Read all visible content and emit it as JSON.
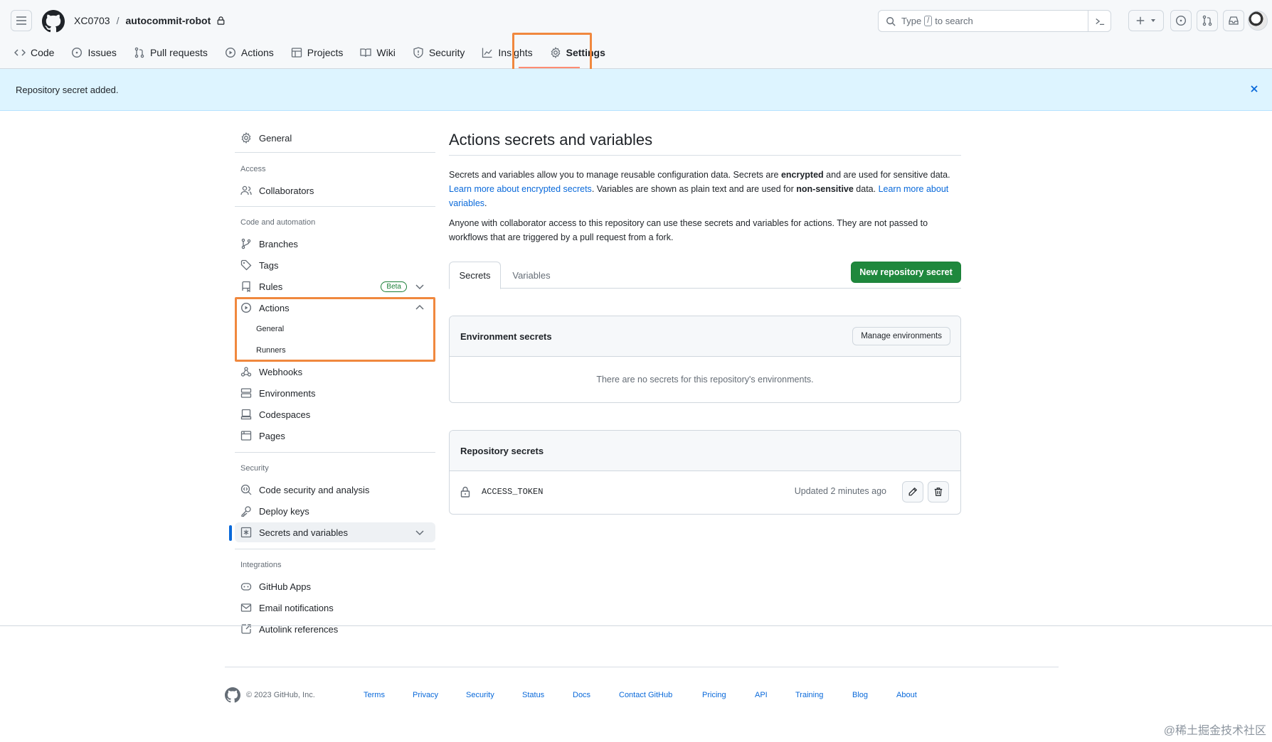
{
  "header": {
    "owner": "XC0703",
    "separator": "/",
    "repo": "autocommit-robot",
    "search": {
      "prefix": "Type",
      "key": "/",
      "suffix": "to search"
    }
  },
  "tabs": [
    {
      "label": "Code",
      "icon": "code-icon"
    },
    {
      "label": "Issues",
      "icon": "issue-opened-icon"
    },
    {
      "label": "Pull requests",
      "icon": "git-pull-request-icon"
    },
    {
      "label": "Actions",
      "icon": "play-icon"
    },
    {
      "label": "Projects",
      "icon": "table-icon"
    },
    {
      "label": "Wiki",
      "icon": "book-icon"
    },
    {
      "label": "Security",
      "icon": "shield-icon"
    },
    {
      "label": "Insights",
      "icon": "graph-icon"
    },
    {
      "label": "Settings",
      "icon": "gear-icon",
      "selected": true
    }
  ],
  "flash": {
    "message": "Repository secret added."
  },
  "sidebar": {
    "general": "General",
    "access_heading": "Access",
    "collaborators": "Collaborators",
    "code_heading": "Code and automation",
    "branches": "Branches",
    "tags": "Tags",
    "rules": "Rules",
    "rules_badge": "Beta",
    "actions": "Actions",
    "actions_general": "General",
    "actions_runners": "Runners",
    "webhooks": "Webhooks",
    "environments": "Environments",
    "codespaces": "Codespaces",
    "pages": "Pages",
    "security_heading": "Security",
    "code_security": "Code security and analysis",
    "deploy_keys": "Deploy keys",
    "secrets": "Secrets and variables",
    "integrations_heading": "Integrations",
    "github_apps": "GitHub Apps",
    "email": "Email notifications",
    "autolink": "Autolink references"
  },
  "main": {
    "title": "Actions secrets and variables",
    "p1_a": "Secrets and variables allow you to manage reusable configuration data. Secrets are ",
    "p1_b": "encrypted",
    "p1_c": " and are used for sensitive data. ",
    "p1_link1": "Learn more about encrypted secrets",
    "p1_d": ". Variables are shown as plain text and are used for ",
    "p1_e": "non-sensitive",
    "p1_f": " data. ",
    "p1_link2": "Learn more about variables",
    "p1_g": ".",
    "p2": "Anyone with collaborator access to this repository can use these secrets and variables for actions. They are not passed to workflows that are triggered by a pull request from a fork.",
    "tab_secrets": "Secrets",
    "tab_variables": "Variables",
    "new_secret_button": "New repository secret",
    "env_heading": "Environment secrets",
    "manage_env_button": "Manage environments",
    "env_empty": "There are no secrets for this repository's environments.",
    "repo_heading": "Repository secrets",
    "secrets": [
      {
        "name": "ACCESS_TOKEN",
        "updated": "Updated 2 minutes ago"
      }
    ]
  },
  "footer": {
    "copyright": "© 2023 GitHub, Inc.",
    "links": [
      "Terms",
      "Privacy",
      "Security",
      "Status",
      "Docs",
      "Contact GitHub",
      "Pricing",
      "API",
      "Training",
      "Blog",
      "About"
    ]
  },
  "watermark": "@稀土掘金技术社区",
  "colors": {
    "accent": "#0969da",
    "primary_button": "#1f883d",
    "highlight": "#f0883e",
    "flash_bg": "#ddf4ff"
  }
}
